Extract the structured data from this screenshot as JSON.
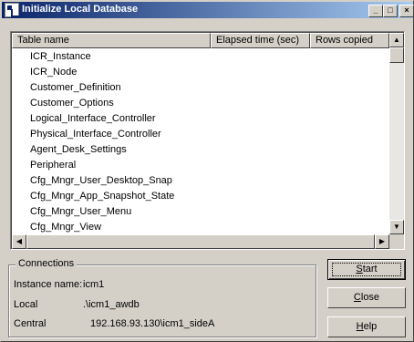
{
  "window": {
    "title": "Initialize Local Database",
    "minimize_glyph": "_",
    "maximize_glyph": "□",
    "close_glyph": "×"
  },
  "table": {
    "columns": [
      "Table name",
      "Elapsed time (sec)",
      "Rows copied"
    ],
    "rows": [
      "ICR_Instance",
      "ICR_Node",
      "Customer_Definition",
      "Customer_Options",
      "Logical_Interface_Controller",
      "Physical_Interface_Controller",
      "Agent_Desk_Settings",
      "Peripheral",
      "Cfg_Mngr_User_Desktop_Snap",
      "Cfg_Mngr_App_Snapshot_State",
      "Cfg_Mngr_User_Menu",
      "Cfg_Mngr_View"
    ]
  },
  "scrollbar": {
    "up_glyph": "▲",
    "down_glyph": "▼",
    "left_glyph": "◀",
    "right_glyph": "▶"
  },
  "connections": {
    "label": "Connections",
    "instance_label": "Instance name:",
    "instance_value": "icm1",
    "local_label": "Local",
    "local_value": ".\\icm1_awdb",
    "central_label": "Central",
    "central_value": "192.168.93.130\\icm1_sideA"
  },
  "buttons": {
    "start_mnemonic": "S",
    "start_rest": "tart",
    "close_mnemonic": "C",
    "close_rest": "lose",
    "help_mnemonic": "H",
    "help_rest": "elp"
  }
}
